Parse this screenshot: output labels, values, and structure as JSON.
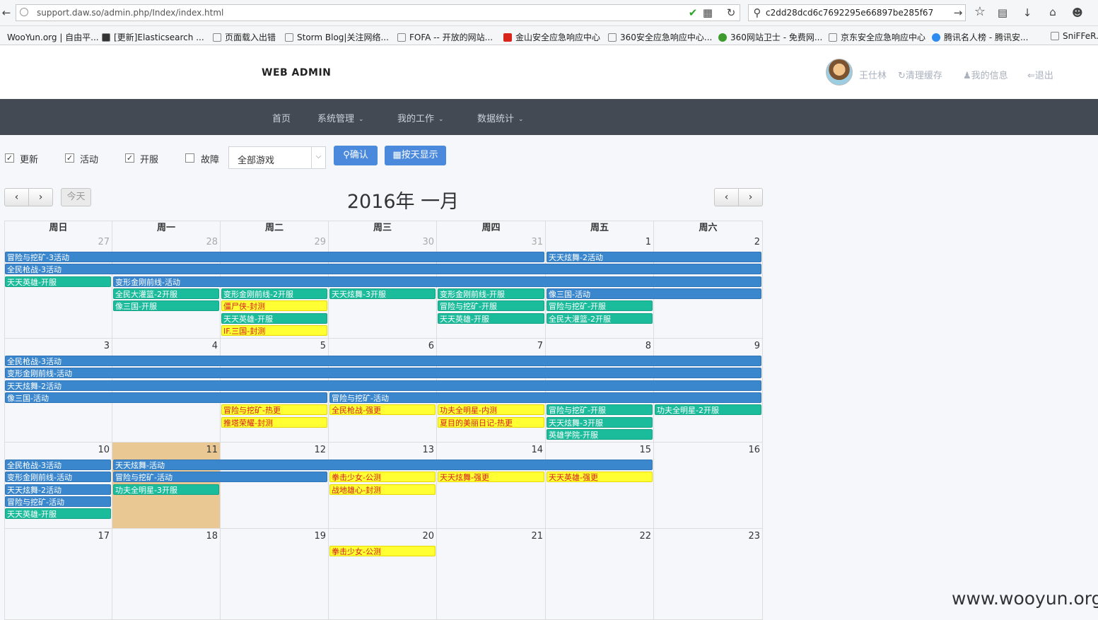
{
  "browser": {
    "url": "support.daw.so/admin.php/Index/index.html",
    "search": "c2dd28dcd6c7692295e66897be285f67",
    "bookmarks": [
      "WooYun.org | 自由平...",
      "[更新]Elasticsearch ...",
      "页面载入出错",
      "Storm Blog|关注网络...",
      "FOFA -- 开放的网站...",
      "金山安全应急响应中心",
      "360安全应急响应中心...",
      "360网站卫士 - 免费网...",
      "京东安全应急响应中心",
      "腾讯名人榜 - 腾讯安...",
      "SniFFeR..."
    ]
  },
  "header": {
    "brand": "WEB ADMIN",
    "user": "王仕林",
    "clear_cache": "清理缓存",
    "my_info": "我的信息",
    "logout": "退出"
  },
  "nav": {
    "home": "首页",
    "system": "系统管理",
    "work": "我的工作",
    "stats": "数据统计"
  },
  "filters": {
    "update": {
      "label": "更新",
      "checked": true
    },
    "activity": {
      "label": "活动",
      "checked": true
    },
    "open": {
      "label": "开服",
      "checked": true
    },
    "fault": {
      "label": "故障",
      "checked": false
    },
    "game_select": "全部游戏",
    "confirm": "确认",
    "by_day": "按天显示"
  },
  "calendar": {
    "title": "2016年 一月",
    "today": "今天",
    "weekdays": [
      "周日",
      "周一",
      "周二",
      "周三",
      "周四",
      "周五",
      "周六"
    ],
    "weeks": [
      {
        "days": [
          "27",
          "28",
          "29",
          "30",
          "31",
          "1",
          "2"
        ],
        "other_month": [
          true,
          true,
          true,
          true,
          true,
          false,
          false
        ]
      },
      {
        "days": [
          "3",
          "4",
          "5",
          "6",
          "7",
          "8",
          "9"
        ],
        "other_month": [
          false,
          false,
          false,
          false,
          false,
          false,
          false
        ]
      },
      {
        "days": [
          "10",
          "11",
          "12",
          "13",
          "14",
          "15",
          "16"
        ],
        "other_month": [
          false,
          false,
          false,
          false,
          false,
          false,
          false
        ]
      },
      {
        "days": [
          "17",
          "18",
          "19",
          "20",
          "21",
          "22",
          "23"
        ],
        "other_month": [
          false,
          false,
          false,
          false,
          false,
          false,
          false
        ]
      }
    ],
    "today_week": 2,
    "today_col": 1,
    "events": [
      {
        "w": 0,
        "c": 0,
        "s": 5,
        "r": 0,
        "t": "冒险与挖矿-3活动",
        "k": "blue"
      },
      {
        "w": 0,
        "c": 5,
        "s": 2,
        "r": 0,
        "t": "天天炫舞-2活动",
        "k": "blue"
      },
      {
        "w": 0,
        "c": 0,
        "s": 7,
        "r": 1,
        "t": "全民枪战-3活动",
        "k": "blue"
      },
      {
        "w": 0,
        "c": 0,
        "s": 1,
        "r": 2,
        "t": "天天英雄-开服",
        "k": "green"
      },
      {
        "w": 0,
        "c": 1,
        "s": 6,
        "r": 2,
        "t": "变形金刚前线-活动",
        "k": "blue"
      },
      {
        "w": 0,
        "c": 1,
        "s": 1,
        "r": 3,
        "t": "全民大灌篮-2开服",
        "k": "green"
      },
      {
        "w": 0,
        "c": 2,
        "s": 1,
        "r": 3,
        "t": "变形金刚前线-2开服",
        "k": "green"
      },
      {
        "w": 0,
        "c": 3,
        "s": 1,
        "r": 3,
        "t": "天天炫舞-3开服",
        "k": "green"
      },
      {
        "w": 0,
        "c": 4,
        "s": 1,
        "r": 3,
        "t": "变形金刚前线-开服",
        "k": "green"
      },
      {
        "w": 0,
        "c": 5,
        "s": 2,
        "r": 3,
        "t": "像三国-活动",
        "k": "blue"
      },
      {
        "w": 0,
        "c": 1,
        "s": 1,
        "r": 4,
        "t": "像三国-开服",
        "k": "green"
      },
      {
        "w": 0,
        "c": 2,
        "s": 1,
        "r": 4,
        "t": "僵尸侠-封测",
        "k": "yellow"
      },
      {
        "w": 0,
        "c": 4,
        "s": 1,
        "r": 4,
        "t": "冒险与挖矿-开服",
        "k": "green"
      },
      {
        "w": 0,
        "c": 5,
        "s": 1,
        "r": 4,
        "t": "冒险与挖矿-开服",
        "k": "green"
      },
      {
        "w": 0,
        "c": 2,
        "s": 1,
        "r": 5,
        "t": "天天英雄-开服",
        "k": "green"
      },
      {
        "w": 0,
        "c": 4,
        "s": 1,
        "r": 5,
        "t": "天天英雄-开服",
        "k": "green"
      },
      {
        "w": 0,
        "c": 5,
        "s": 1,
        "r": 5,
        "t": "全民大灌篮-2开服",
        "k": "green"
      },
      {
        "w": 0,
        "c": 2,
        "s": 1,
        "r": 6,
        "t": "IF.三国-封测",
        "k": "yellow"
      },
      {
        "w": 1,
        "c": 0,
        "s": 7,
        "r": 0,
        "t": "全民枪战-3活动",
        "k": "blue"
      },
      {
        "w": 1,
        "c": 0,
        "s": 7,
        "r": 1,
        "t": "变形金刚前线-活动",
        "k": "blue"
      },
      {
        "w": 1,
        "c": 0,
        "s": 7,
        "r": 2,
        "t": "天天炫舞-2活动",
        "k": "blue"
      },
      {
        "w": 1,
        "c": 0,
        "s": 3,
        "r": 3,
        "t": "像三国-活动",
        "k": "blue"
      },
      {
        "w": 1,
        "c": 3,
        "s": 4,
        "r": 3,
        "t": "冒险与挖矿-活动",
        "k": "blue"
      },
      {
        "w": 1,
        "c": 2,
        "s": 1,
        "r": 4,
        "t": "冒险与挖矿-热更",
        "k": "yellow"
      },
      {
        "w": 1,
        "c": 3,
        "s": 1,
        "r": 4,
        "t": "全民枪战-强更",
        "k": "yellow"
      },
      {
        "w": 1,
        "c": 4,
        "s": 1,
        "r": 4,
        "t": "功夫全明星-内测",
        "k": "yellow"
      },
      {
        "w": 1,
        "c": 5,
        "s": 1,
        "r": 4,
        "t": "冒险与挖矿-开服",
        "k": "green"
      },
      {
        "w": 1,
        "c": 6,
        "s": 1,
        "r": 4,
        "t": "功夫全明星-2开服",
        "k": "green"
      },
      {
        "w": 1,
        "c": 2,
        "s": 1,
        "r": 5,
        "t": "推塔荣耀-封测",
        "k": "yellow"
      },
      {
        "w": 1,
        "c": 4,
        "s": 1,
        "r": 5,
        "t": "夏目的美丽日记-热更",
        "k": "yellow"
      },
      {
        "w": 1,
        "c": 5,
        "s": 1,
        "r": 5,
        "t": "天天炫舞-3开服",
        "k": "green"
      },
      {
        "w": 1,
        "c": 5,
        "s": 1,
        "r": 6,
        "t": "英雄学院-开服",
        "k": "green"
      },
      {
        "w": 2,
        "c": 0,
        "s": 1,
        "r": 0,
        "t": "全民枪战-3活动",
        "k": "blue"
      },
      {
        "w": 2,
        "c": 1,
        "s": 5,
        "r": 0,
        "t": "天天炫舞-活动",
        "k": "blue"
      },
      {
        "w": 2,
        "c": 0,
        "s": 1,
        "r": 1,
        "t": "变形金刚前线-活动",
        "k": "blue"
      },
      {
        "w": 2,
        "c": 1,
        "s": 2,
        "r": 1,
        "t": "冒险与挖矿-活动",
        "k": "blue"
      },
      {
        "w": 2,
        "c": 3,
        "s": 1,
        "r": 1,
        "t": "拳击少女-公测",
        "k": "yellow"
      },
      {
        "w": 2,
        "c": 4,
        "s": 1,
        "r": 1,
        "t": "天天炫舞-强更",
        "k": "yellow"
      },
      {
        "w": 2,
        "c": 5,
        "s": 1,
        "r": 1,
        "t": "天天英雄-强更",
        "k": "yellow"
      },
      {
        "w": 2,
        "c": 0,
        "s": 1,
        "r": 2,
        "t": "天天炫舞-2活动",
        "k": "blue"
      },
      {
        "w": 2,
        "c": 1,
        "s": 1,
        "r": 2,
        "t": "功夫全明星-3开服",
        "k": "green"
      },
      {
        "w": 2,
        "c": 3,
        "s": 1,
        "r": 2,
        "t": "战地雄心-封测",
        "k": "yellow"
      },
      {
        "w": 2,
        "c": 0,
        "s": 1,
        "r": 3,
        "t": "冒险与挖矿-活动",
        "k": "blue"
      },
      {
        "w": 2,
        "c": 0,
        "s": 1,
        "r": 4,
        "t": "天天英雄-开服",
        "k": "green"
      },
      {
        "w": 3,
        "c": 3,
        "s": 1,
        "r": 0,
        "t": "拳击少女-公测",
        "k": "yellow"
      }
    ]
  },
  "watermark": "www.wooyun.org"
}
